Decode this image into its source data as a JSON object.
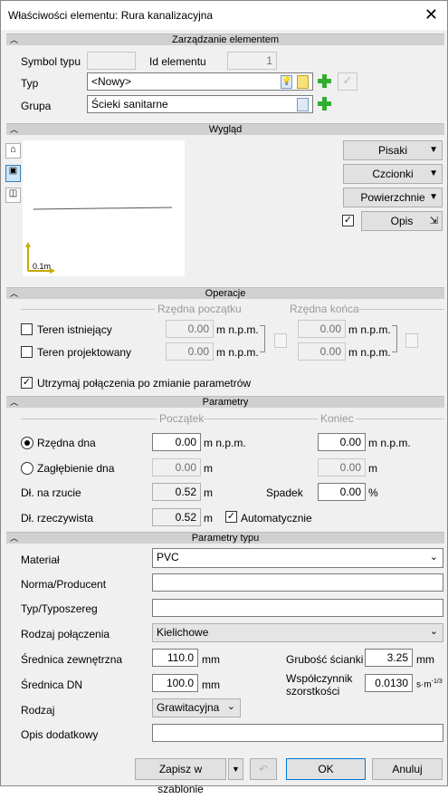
{
  "window": {
    "title": "Właściwości elementu: Rura kanalizacyjna"
  },
  "sections": {
    "zarzadzanie": "Zarządzanie elementem",
    "wyglad": "Wygląd",
    "operacje": "Operacje",
    "parametry": "Parametry",
    "parametry_typu": "Parametry typu"
  },
  "zarzadzanie": {
    "symbol_label": "Symbol typu",
    "symbol_value": "",
    "id_label": "Id elementu",
    "id_value": "1",
    "typ_label": "Typ",
    "typ_value": "<Nowy>",
    "grupa_label": "Grupa",
    "grupa_value": "Ścieki sanitarne"
  },
  "wyglad": {
    "scale_label": "0.1m",
    "pisaki": "Pisaki",
    "czcionki": "Czcionki",
    "powierzchnie": "Powierzchnie",
    "opis": "Opis",
    "opis_checked": true
  },
  "operacje": {
    "rzedna_poczatku": "Rzędna początku",
    "rzedna_konca": "Rzędna końca",
    "teren_istniejacy": "Teren istniejący",
    "teren_projektowany": "Teren projektowany",
    "val1": "0.00",
    "val2": "0.00",
    "val3": "0.00",
    "val4": "0.00",
    "unit": "m n.p.m.",
    "utrzymaj": "Utrzymaj połączenia po zmianie parametrów"
  },
  "parametry": {
    "poczatek": "Początek",
    "koniec": "Koniec",
    "rzedna_dna": "Rzędna dna",
    "rzedna_dna_p": "0.00",
    "rzedna_dna_k": "0.00",
    "unit_npm": "m n.p.m.",
    "zaglebienie": "Zagłębienie dna",
    "zagl_p": "0.00",
    "zagl_k": "0.00",
    "unit_m": "m",
    "dl_rzut_label": "Dł. na rzucie",
    "dl_rzut": "0.52",
    "spadek_label": "Spadek",
    "spadek": "0.00",
    "unit_pct": "%",
    "dl_rzecz_label": "Dł. rzeczywista",
    "dl_rzecz": "0.52",
    "automatycznie": "Automatycznie"
  },
  "parametry_typu": {
    "material_label": "Materiał",
    "material": "PVC",
    "norma_label": "Norma/Producent",
    "norma": "",
    "typ_label": "Typ/Typoszereg",
    "typ": "",
    "polaczenie_label": "Rodzaj połączenia",
    "polaczenie": "Kielichowe",
    "srednica_zew_label": "Średnica zewnętrzna",
    "srednica_zew": "110.0",
    "unit_mm": "mm",
    "grubosc_label": "Grubość ścianki",
    "grubosc": "3.25",
    "srednica_dn_label": "Średnica DN",
    "srednica_dn": "100.0",
    "wspolczynnik_label1": "Współczynnik",
    "wspolczynnik_label2": "szorstkości",
    "wspolczynnik": "0.0130",
    "wsp_unit": "s·m",
    "wsp_exp": "-1/3",
    "rodzaj_label": "Rodzaj",
    "rodzaj": "Grawitacyjna",
    "opis_label": "Opis dodatkowy",
    "opis": ""
  },
  "footer": {
    "zapisz": "Zapisz w szablonie",
    "ok": "OK",
    "anuluj": "Anuluj"
  }
}
